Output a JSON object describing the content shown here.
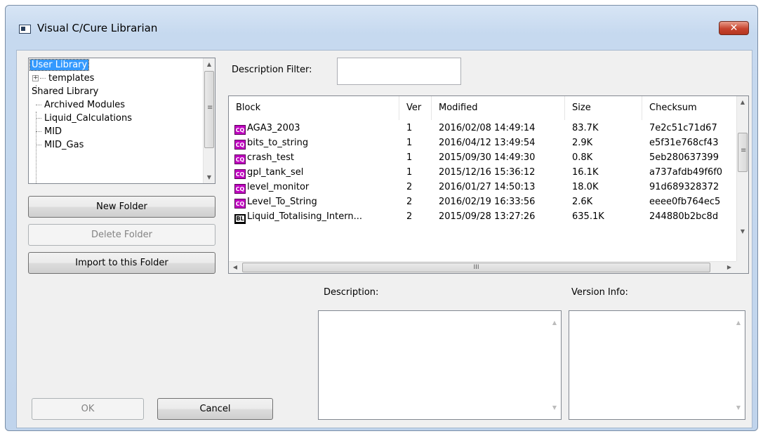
{
  "window": {
    "title": "Visual C/Cure Librarian",
    "close_label": "✕"
  },
  "tree": {
    "items": [
      {
        "label": "User Library",
        "selected": true
      },
      {
        "label": "templates",
        "expander": "+"
      },
      {
        "label": "Shared Library"
      },
      {
        "label": "Archived Modules"
      },
      {
        "label": "Liquid_Calculations"
      },
      {
        "label": "MID"
      },
      {
        "label": "MID_Gas"
      }
    ]
  },
  "buttons": {
    "new_folder": "New Folder",
    "delete_folder": "Delete Folder",
    "import_folder": "Import to this Folder",
    "ok": "OK",
    "cancel": "Cancel"
  },
  "filter": {
    "label": "Description Filter:",
    "value": ""
  },
  "grid": {
    "columns": [
      "Block",
      "Ver",
      "Modified",
      "Size",
      "Checksum"
    ],
    "rows": [
      {
        "icon": "CQ",
        "block": "AGA3_2003",
        "ver": "1",
        "modified": "2016/02/08 14:49:14",
        "size": "83.7K",
        "checksum": "7e2c51c71d67"
      },
      {
        "icon": "CQ",
        "block": "bits_to_string",
        "ver": "1",
        "modified": "2016/04/12 13:49:54",
        "size": "2.9K",
        "checksum": "e5f31e768cf43"
      },
      {
        "icon": "CQ",
        "block": "crash_test",
        "ver": "1",
        "modified": "2015/09/30 14:49:30",
        "size": "0.8K",
        "checksum": "5eb280637399"
      },
      {
        "icon": "CQ",
        "block": "gpl_tank_sel",
        "ver": "1",
        "modified": "2015/12/16 15:36:12",
        "size": "16.1K",
        "checksum": "a737afdb49f6f0"
      },
      {
        "icon": "CQ",
        "block": "level_monitor",
        "ver": "2",
        "modified": "2016/01/27 14:50:13",
        "size": "18.0K",
        "checksum": "91d689328372"
      },
      {
        "icon": "CQ",
        "block": "Level_To_String",
        "ver": "2",
        "modified": "2016/02/19 16:33:56",
        "size": "2.6K",
        "checksum": "eeee0fb764ec5"
      },
      {
        "icon": "BL",
        "block": "Liquid_Totalising_Intern...",
        "ver": "2",
        "modified": "2015/09/28 13:27:26",
        "size": "635.1K",
        "checksum": "244880b2bc8d"
      }
    ],
    "hscroll_grip": "III"
  },
  "description": {
    "label": "Description:",
    "value": ""
  },
  "version_info": {
    "label": "Version Info:",
    "value": ""
  },
  "colors": {
    "selection": "#3399ff",
    "cq_icon": "#c000c0",
    "close_button": "#c7442e"
  }
}
